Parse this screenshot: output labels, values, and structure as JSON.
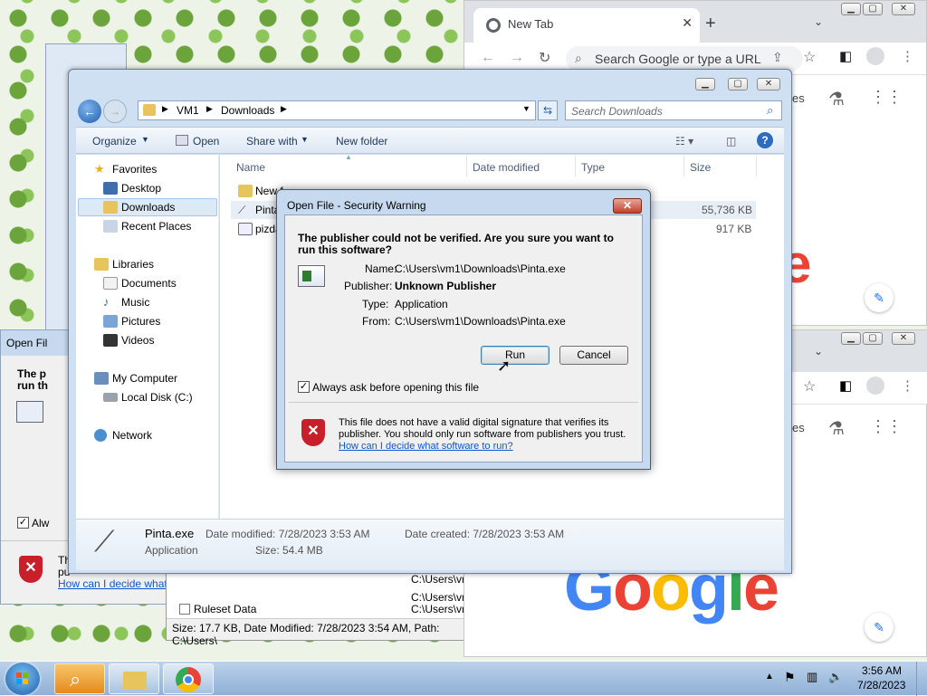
{
  "chrome_top": {
    "tab_title": "New Tab",
    "omnibox_placeholder": "Search Google or type a URL",
    "side_text": "es"
  },
  "chrome_bottom": {
    "side_text": "es",
    "logo": "Google"
  },
  "left_dialog_fragment": {
    "title": "Open Fil",
    "line1": "The p",
    "line2": "run th",
    "always": "Alw",
    "link": "How can I decide what software to run?",
    "text_frag1": "Th",
    "text_frag2": "pu"
  },
  "behind_list": {
    "rows": [
      {
        "path": "C:\\Users\\vr"
      },
      {
        "path": "C:\\Users\\vr"
      },
      {
        "name": "Ruleset Data",
        "path": "C:\\Users\\vr"
      }
    ],
    "status": "Size: 17.7 KB, Date Modified: 7/28/2023 3:54 AM, Path: C:\\Users\\"
  },
  "explorer": {
    "breadcrumb": [
      "VM1",
      "Downloads"
    ],
    "search_placeholder": "Search Downloads",
    "toolbar": {
      "organize": "Organize",
      "open": "Open",
      "share": "Share with",
      "new_folder": "New folder"
    },
    "nav": {
      "favorites": "Favorites",
      "desktop": "Desktop",
      "downloads": "Downloads",
      "recent": "Recent Places",
      "libraries": "Libraries",
      "documents": "Documents",
      "music": "Music",
      "pictures": "Pictures",
      "videos": "Videos",
      "computer": "My Computer",
      "local_disk": "Local Disk (C:)",
      "network": "Network"
    },
    "columns": {
      "name": "Name",
      "date": "Date modified",
      "type": "Type",
      "size": "Size"
    },
    "files": [
      {
        "name": "New f",
        "size": ""
      },
      {
        "name": "Pinta",
        "size": "55,736 KB"
      },
      {
        "name": "pizda",
        "size": "917 KB"
      }
    ],
    "details": {
      "filename": "Pinta.exe",
      "filetype": "Application",
      "modified": "Date modified: 7/28/2023 3:53 AM",
      "size": "Size: 54.4 MB",
      "created": "Date created: 7/28/2023 3:53 AM"
    }
  },
  "dialog": {
    "title": "Open File - Security Warning",
    "heading": "The publisher could not be verified.  Are you sure you want to run this software?",
    "fields": [
      {
        "label": "Name:",
        "value": "C:\\Users\\vm1\\Downloads\\Pinta.exe",
        "bold": false
      },
      {
        "label": "Publisher:",
        "value": "Unknown Publisher",
        "bold": true
      },
      {
        "label": "Type:",
        "value": "Application",
        "bold": false
      },
      {
        "label": "From:",
        "value": "C:\\Users\\vm1\\Downloads\\Pinta.exe",
        "bold": false
      }
    ],
    "run": "Run",
    "cancel": "Cancel",
    "always_ask": "Always ask before opening this file",
    "always_ask_checked": true,
    "warning": "This file does not have a valid digital signature that verifies its publisher.  You should only run software from publishers you trust.",
    "link": "How can I decide what software to run?"
  },
  "taskbar": {
    "time": "3:56 AM",
    "date": "7/28/2023"
  }
}
